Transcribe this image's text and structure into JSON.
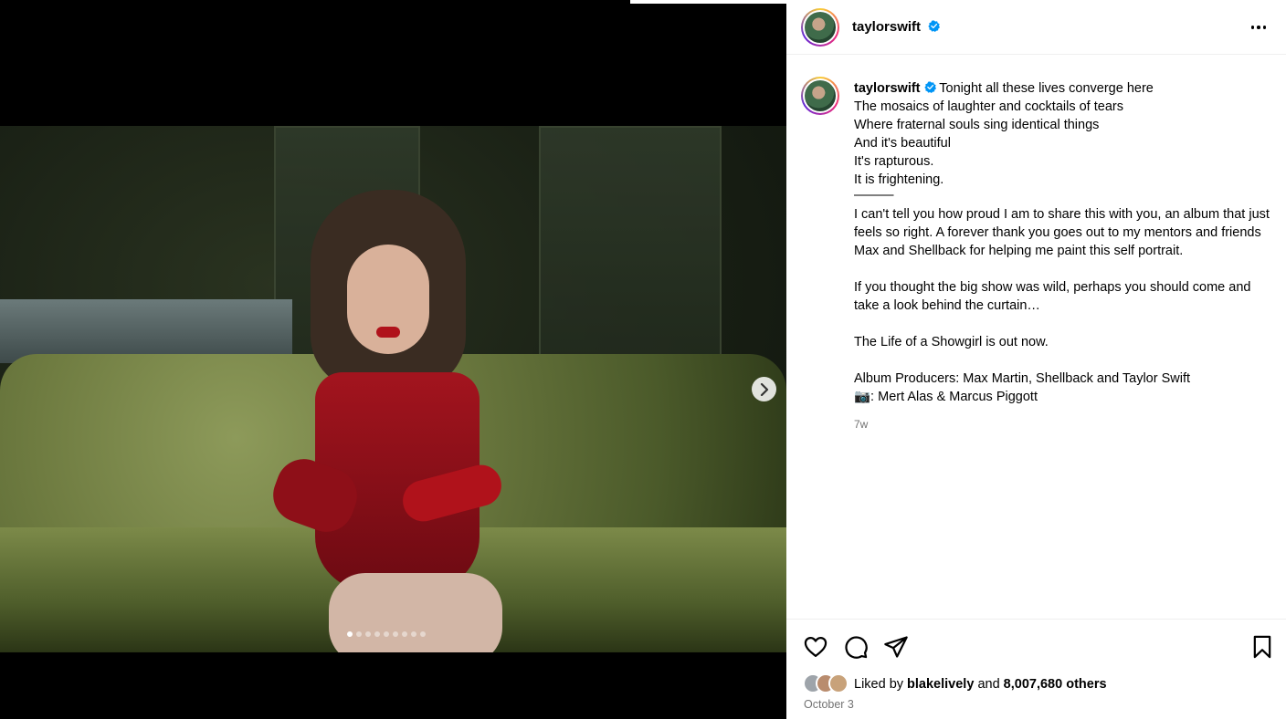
{
  "post": {
    "username": "taylorswift",
    "caption_user": "taylorswift",
    "caption_lines": [
      "Tonight all these lives converge here",
      "The mosaics of laughter and cocktails of tears",
      "Where fraternal souls sing identical things",
      "And it's beautiful",
      "It's rapturous.",
      "It is frightening.",
      "———",
      "I can't tell you how proud I am to share this with you, an album that just feels so right. A forever thank you goes out to my mentors and friends Max and Shellback for helping me paint this self portrait.",
      "",
      "If you thought the big show was wild, perhaps you should come and take a look behind the curtain…",
      "",
      "The Life of a Showgirl is out now.",
      "",
      "Album Producers: Max Martin, Shellback and Taylor Swift",
      "📷: Mert Alas & Marcus Piggott"
    ],
    "time_ago": "7w",
    "likes": {
      "prefix": "Liked by",
      "user": "blakelively",
      "and": "and",
      "count": "8,007,680 others"
    },
    "date": "October 3"
  },
  "carousel": {
    "current": 1,
    "total": 9
  },
  "icons": [
    "verified-badge-icon",
    "more-options-icon",
    "heart-icon",
    "comment-icon",
    "share-icon",
    "bookmark-icon",
    "chevron-right-icon"
  ],
  "colors": {
    "verified": "#0095f6",
    "muted": "#737373",
    "divider": "#efefef"
  }
}
